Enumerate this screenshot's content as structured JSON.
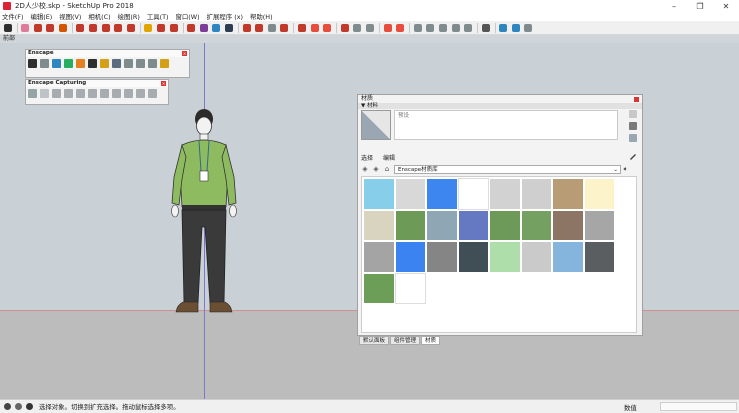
{
  "window": {
    "title": "2D人少校.skp - SketchUp Pro 2018",
    "minimize": "–",
    "maximize": "❐",
    "close": "✕"
  },
  "menu": [
    "文件(F)",
    "编辑(E)",
    "视图(V)",
    "相机(C)",
    "绘图(R)",
    "工具(T)",
    "窗口(W)",
    "扩展程序 (x)",
    "帮助(H)"
  ],
  "toolbar_icons": [
    {
      "name": "select-icon",
      "color": "#2f2f2f"
    },
    {
      "name": "sep"
    },
    {
      "name": "eraser-icon",
      "color": "#e07a9a"
    },
    {
      "name": "line-icon",
      "color": "#c0392b"
    },
    {
      "name": "arc-icon",
      "color": "#c0392b"
    },
    {
      "name": "shape-icon",
      "color": "#d35400"
    },
    {
      "name": "sep"
    },
    {
      "name": "push-pull-icon",
      "color": "#c0392b"
    },
    {
      "name": "move-icon",
      "color": "#c0392b"
    },
    {
      "name": "rotate-icon",
      "color": "#c0392b"
    },
    {
      "name": "scale-icon",
      "color": "#c0392b"
    },
    {
      "name": "offset-icon",
      "color": "#c0392b"
    },
    {
      "name": "sep"
    },
    {
      "name": "tape-measure-icon",
      "color": "#e2a400"
    },
    {
      "name": "text-icon",
      "color": "#c0392b"
    },
    {
      "name": "paint-bucket-icon",
      "color": "#c0392b"
    },
    {
      "name": "sep"
    },
    {
      "name": "orbit-icon",
      "color": "#c0392b"
    },
    {
      "name": "pan-icon",
      "color": "#7d3c98"
    },
    {
      "name": "zoom-icon",
      "color": "#2e86c1"
    },
    {
      "name": "zoom-extents-icon",
      "color": "#2c3e50"
    },
    {
      "name": "sep"
    },
    {
      "name": "warehouse-icon",
      "color": "#c0392b"
    },
    {
      "name": "extension-warehouse-icon",
      "color": "#c0392b"
    },
    {
      "name": "components-icon",
      "color": "#7f8c8d"
    },
    {
      "name": "layout-icon",
      "color": "#c0392b"
    },
    {
      "name": "sep"
    },
    {
      "name": "encape-logo-icon",
      "color": "#c0392b"
    },
    {
      "name": "render-icon",
      "color": "#e74c3c"
    },
    {
      "name": "camera-icon",
      "color": "#e74c3c"
    },
    {
      "name": "sep"
    },
    {
      "name": "audio-icon",
      "color": "#c0392b"
    },
    {
      "name": "tag-icon",
      "color": "#7f8c8d"
    },
    {
      "name": "dimension-icon",
      "color": "#7f8c8d"
    },
    {
      "name": "sep"
    },
    {
      "name": "settings-icon",
      "color": "#e74c3c"
    },
    {
      "name": "grid-icon",
      "color": "#e74c3c"
    },
    {
      "name": "sep"
    },
    {
      "name": "page-icon",
      "color": "#7f8c8d"
    },
    {
      "name": "folder-icon",
      "color": "#7f8c8d"
    },
    {
      "name": "export-icon",
      "color": "#7f8c8d"
    },
    {
      "name": "print-icon",
      "color": "#7f8c8d"
    },
    {
      "name": "model-info-icon",
      "color": "#7f8c8d"
    },
    {
      "name": "sep"
    },
    {
      "name": "list-icon",
      "color": "#555555"
    },
    {
      "name": "sep"
    },
    {
      "name": "axis-icon",
      "color": "#2e86c1"
    },
    {
      "name": "entity-icon",
      "color": "#2e86c1"
    },
    {
      "name": "gear-icon",
      "color": "#7f8c8d"
    }
  ],
  "scene_tab": "前部",
  "encape": {
    "title": "Enscape",
    "buttons": [
      "#2f2f2f",
      "#7f8c8d",
      "#2e86c1",
      "#27ae60",
      "#e67e22",
      "#2f2f2f",
      "#d4a017",
      "#5d6d7e",
      "#7f8c8d",
      "#7f8c8d",
      "#7f8c8d",
      "#d4a017"
    ]
  },
  "capture": {
    "title": "Enscape Capturing",
    "buttons": [
      "#95a5a6",
      "#bdc3c7",
      "#a6acaf",
      "#a6acaf",
      "#a6acaf",
      "#a6acaf",
      "#a6acaf",
      "#a6acaf",
      "#a6acaf",
      "#a6acaf",
      "#a6acaf"
    ]
  },
  "materials": {
    "panel_title": "材质",
    "tray_label": "▼ 材料",
    "name_placeholder": "预设",
    "tabs": {
      "select": "选择",
      "edit": "编辑"
    },
    "library": "Enscape材质库",
    "swatches": [
      "#87ceeb",
      "#d8d8d8",
      "#3d86ef",
      "#ffffff",
      "#d2d2d2",
      "#cfcfcf",
      "#b89c75",
      "#fdf3cb",
      "#d9d4bf",
      "#6e9a58",
      "#8fa6b4",
      "#6479c1",
      "#6d9a58",
      "#74a161",
      "#8d7566",
      "#a6a6a6",
      "#a4a4a4",
      "#3b83f0",
      "#858585",
      "#404f56",
      "#aedfaa",
      "#cacaca",
      "#85b5dc",
      "#5b5e61",
      "#6d9e58",
      "#ffffff"
    ],
    "bottom_tabs": [
      "默认面板",
      "组件管理",
      "材质"
    ]
  },
  "status": {
    "text": "选择对象。切换到扩充选择。拖动鼠标选择多项。",
    "measure_label": "数值",
    "measure_value": ""
  }
}
